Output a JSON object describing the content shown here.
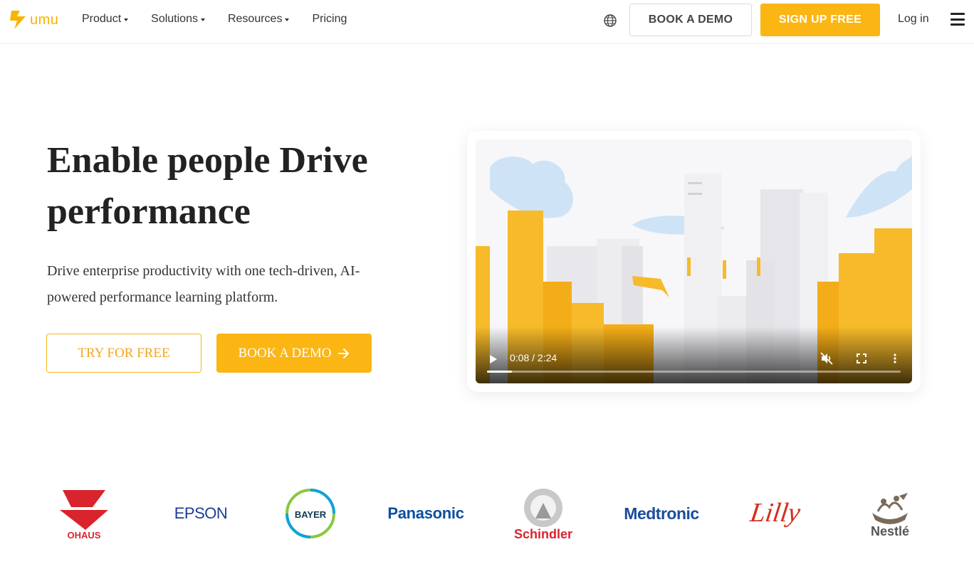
{
  "nav": {
    "logo_text": "umu",
    "menu": [
      {
        "label": "Product",
        "dropdown": true
      },
      {
        "label": "Solutions",
        "dropdown": true
      },
      {
        "label": "Resources",
        "dropdown": true
      },
      {
        "label": "Pricing",
        "dropdown": false
      }
    ],
    "book_demo": "BOOK A DEMO",
    "sign_up": "SIGN UP FREE",
    "log_in": "Log in"
  },
  "hero": {
    "title_line1": "Enable people Drive",
    "title_line2": "performance",
    "subtitle": "Drive enterprise productivity with one tech-driven, AI-powered performance learning platform.",
    "try_free": "TRY FOR FREE",
    "book_demo": "BOOK A DEMO"
  },
  "video": {
    "time": "0:08 / 2:24",
    "progress": 0.06
  },
  "customer_logos": [
    {
      "name": "OHAUS",
      "icon": "ohaus-logo",
      "color": "#d9232d"
    },
    {
      "name": "EPSON",
      "icon": "epson-logo",
      "color": "#1e3c96"
    },
    {
      "name": "BAYER",
      "icon": "bayer-logo",
      "color": "#10384f"
    },
    {
      "name": "Panasonic",
      "icon": "panasonic-logo",
      "color": "#0b4ea2"
    },
    {
      "name": "Schindler",
      "icon": "schindler-logo",
      "color": "#d9232d"
    },
    {
      "name": "Medtronic",
      "icon": "medtronic-logo",
      "color": "#1c4c9e"
    },
    {
      "name": "Lilly",
      "icon": "lilly-logo",
      "color": "#d52b1e"
    },
    {
      "name": "Nestlé",
      "icon": "nestle-logo",
      "color": "#555555"
    }
  ],
  "colors": {
    "brand_yellow": "#fbb614",
    "text_dark": "#222222"
  }
}
